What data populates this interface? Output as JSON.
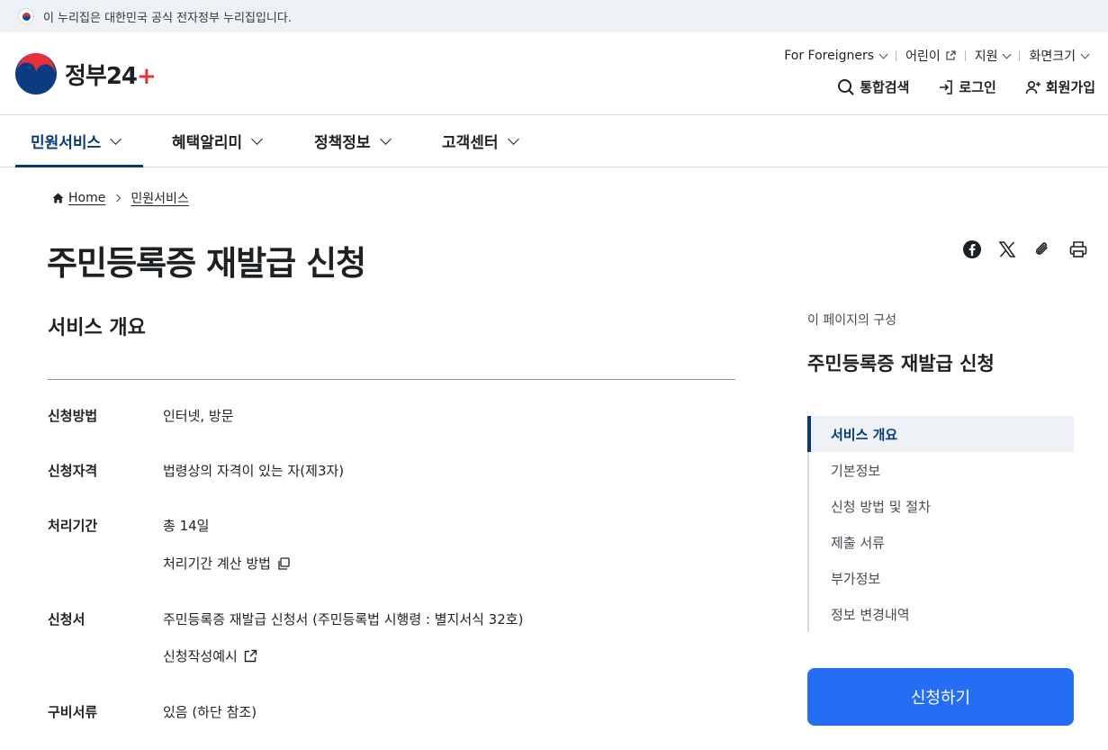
{
  "banner": {
    "text": "이 누리집은 대한민국 공식 전자정부 누리집입니다."
  },
  "logo": {
    "text_main": "정부",
    "text_num": "24",
    "text_plus": "+"
  },
  "util": {
    "foreigners": "For Foreigners",
    "kids": "어린이",
    "support": "지원",
    "screen_size": "화면크기"
  },
  "actions": {
    "search": "통합검색",
    "login": "로그인",
    "signup": "회원가입"
  },
  "gnb": [
    {
      "label": "민원서비스",
      "active": true
    },
    {
      "label": "혜택알리미"
    },
    {
      "label": "정책정보"
    },
    {
      "label": "고객센터"
    }
  ],
  "breadcrumb": {
    "home": "Home",
    "current": "민원서비스"
  },
  "page": {
    "title": "주민등록증 재발급 신청"
  },
  "section": {
    "title": "서비스 개요"
  },
  "details": {
    "method_label": "신청방법",
    "method_value": "인터넷, 방문",
    "eligibility_label": "신청자격",
    "eligibility_value": "법령상의 자격이 있는 자(제3자)",
    "period_label": "처리기간",
    "period_value": "총 14일",
    "period_link": "처리기간 계산 방법",
    "form_label": "신청서",
    "form_value": "주민등록증 재발급 신청서 (주민등록법 시행령 : 별지서식 32호)",
    "form_link": "신청작성예시",
    "docs_label": "구비서류",
    "docs_value": "있음 (하단 참조)"
  },
  "toc": {
    "caption": "이 페이지의 구성",
    "title": "주민등록증 재발급 신청",
    "items": [
      "서비스 개요",
      "기본정보",
      "신청 방법 및 절차",
      "제출 서류",
      "부가정보",
      "정보 변경내역"
    ]
  },
  "apply_button": "신청하기",
  "colors": {
    "primary": "#256ef4",
    "navy": "#063a74",
    "banner_bg": "#eef2f7"
  }
}
